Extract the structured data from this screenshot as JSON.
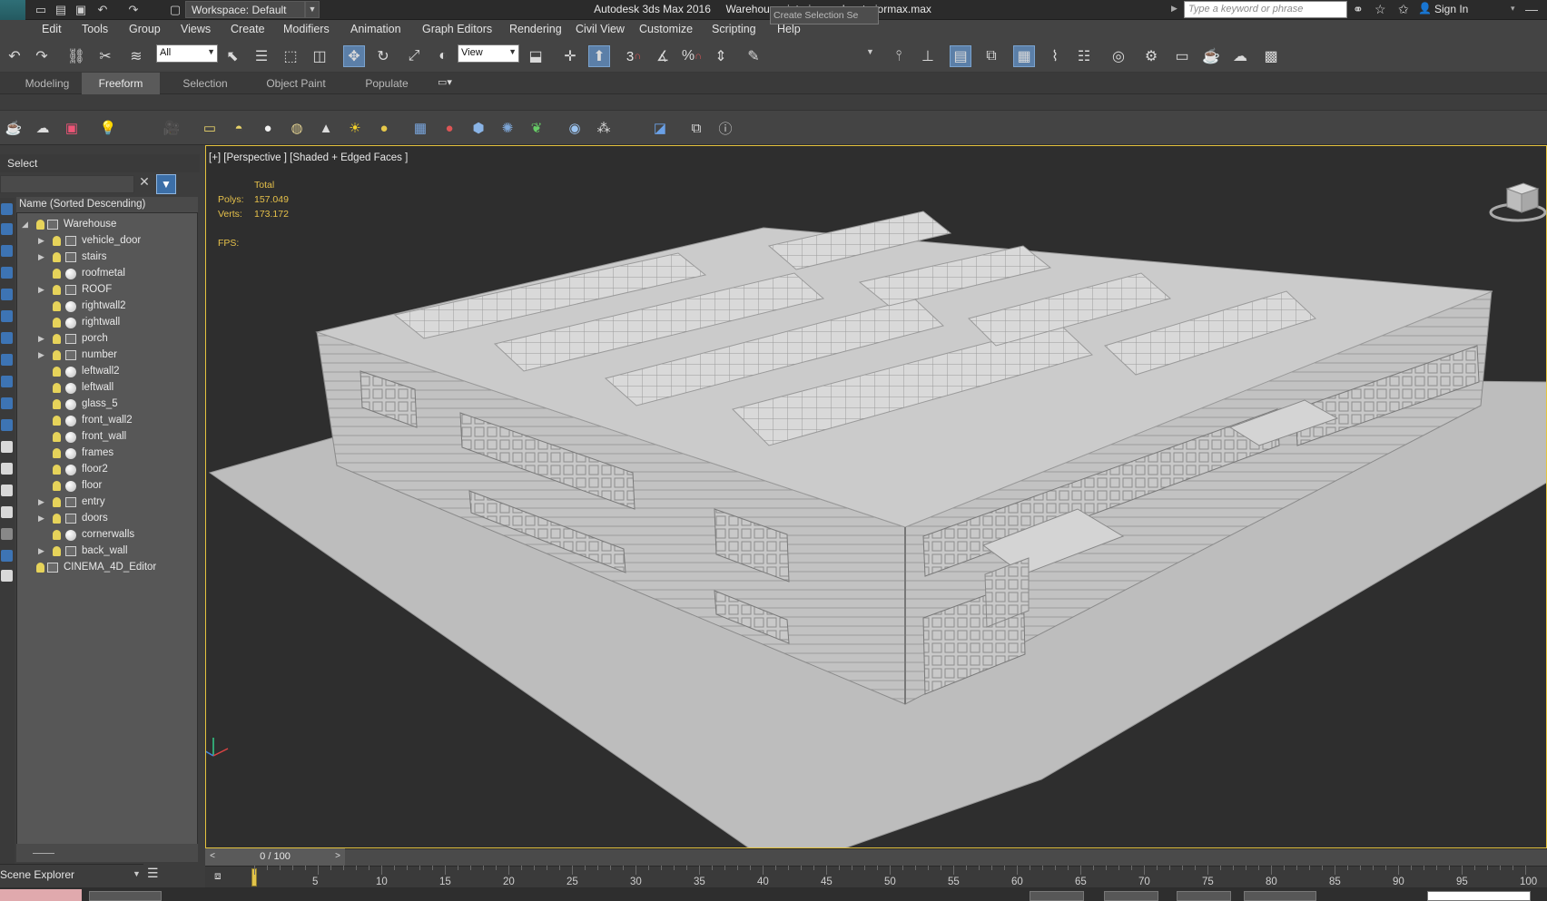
{
  "titlebar": {
    "app_logo": "MAX",
    "workspace": "Workspace: Default",
    "title": "Autodesk 3ds Max 2016     Warehouse_interior_and_exteriormax.max",
    "search_placeholder": "Type a keyword or phrase",
    "sign_in": "Sign In"
  },
  "menu": [
    "Edit",
    "Tools",
    "Group",
    "Views",
    "Create",
    "Modifiers",
    "Animation",
    "Graph Editors",
    "Rendering",
    "Civil View",
    "Customize",
    "Scripting",
    "Help"
  ],
  "toolbar": {
    "filter_value": "All",
    "ref_coord_value": "View",
    "selection_set_placeholder": "Create Selection Se",
    "snap_label": "3",
    "snap_percent_label": "%"
  },
  "ribbon_tabs": [
    {
      "label": "Modeling",
      "active": false
    },
    {
      "label": "Freeform",
      "active": true
    },
    {
      "label": "Selection",
      "active": false
    },
    {
      "label": "Object Paint",
      "active": false
    },
    {
      "label": "Populate",
      "active": false
    }
  ],
  "scene_explorer": {
    "header": "Select",
    "column_header": "Name (Sorted Descending)",
    "tab_label": "Scene Explorer",
    "root": "Warehouse",
    "items": [
      {
        "label": "vehicle_door",
        "expandable": true,
        "kind": "group"
      },
      {
        "label": "stairs",
        "expandable": true,
        "kind": "group"
      },
      {
        "label": "roofmetal",
        "expandable": false,
        "kind": "object"
      },
      {
        "label": "ROOF",
        "expandable": true,
        "kind": "group"
      },
      {
        "label": "rightwall2",
        "expandable": false,
        "kind": "object"
      },
      {
        "label": "rightwall",
        "expandable": false,
        "kind": "object"
      },
      {
        "label": "porch",
        "expandable": true,
        "kind": "group"
      },
      {
        "label": "number",
        "expandable": true,
        "kind": "group"
      },
      {
        "label": "leftwall2",
        "expandable": false,
        "kind": "object"
      },
      {
        "label": "leftwall",
        "expandable": false,
        "kind": "object"
      },
      {
        "label": "glass_5",
        "expandable": false,
        "kind": "object"
      },
      {
        "label": "front_wall2",
        "expandable": false,
        "kind": "object"
      },
      {
        "label": "front_wall",
        "expandable": false,
        "kind": "object"
      },
      {
        "label": "frames",
        "expandable": false,
        "kind": "object"
      },
      {
        "label": "floor2",
        "expandable": false,
        "kind": "object"
      },
      {
        "label": "floor",
        "expandable": false,
        "kind": "object"
      },
      {
        "label": "entry",
        "expandable": true,
        "kind": "group"
      },
      {
        "label": "doors",
        "expandable": true,
        "kind": "group"
      },
      {
        "label": "cornerwalls",
        "expandable": false,
        "kind": "object"
      },
      {
        "label": "back_wall",
        "expandable": true,
        "kind": "group"
      }
    ],
    "extra_root": "CINEMA_4D_Editor"
  },
  "viewport": {
    "label": "[+] [Perspective ] [Shaded + Edged Faces ]",
    "stats_total": "Total",
    "polys_label": "Polys:",
    "polys_value": "157.049",
    "verts_label": "Verts:",
    "verts_value": "173.172",
    "fps_label": "FPS:"
  },
  "timeline": {
    "frame_display": "0 / 100",
    "ticks": [
      "5",
      "10",
      "15",
      "20",
      "25",
      "30",
      "35",
      "40",
      "45",
      "50",
      "55",
      "60",
      "65",
      "70",
      "75",
      "80",
      "85",
      "90",
      "95",
      "100"
    ],
    "current_frame": 0,
    "total_frames": 100
  },
  "colors": {
    "viewport_border": "#e5c33e",
    "stats": "#e6c14a",
    "active_tab": "#5a5a5a",
    "accent_blue": "#5b7fa8"
  }
}
